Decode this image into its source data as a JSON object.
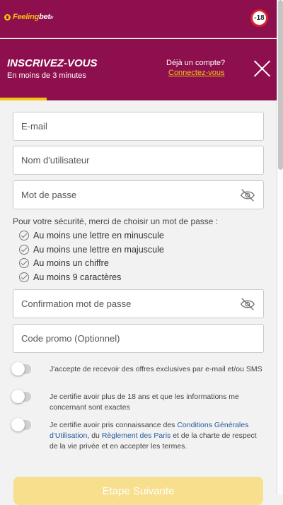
{
  "colors": {
    "brand": "#8e0f4d",
    "accent": "#f4c312",
    "link": "#235b9c",
    "button": "#f7df8e"
  },
  "header": {
    "logo": {
      "main": "Feeling",
      "strong": "bet",
      "suffix": "fr"
    },
    "age_badge": "-18"
  },
  "hero": {
    "title": "INSCRIVEZ-VOUS",
    "subtitle": "En moins de 3 minutes",
    "already": "Déjà un compte?",
    "login": "Connectez-vous",
    "progress": 0.17
  },
  "form": {
    "email_placeholder": "E-mail",
    "username_placeholder": "Nom d'utilisateur",
    "password_placeholder": "Mot de passe",
    "password_rules_title": "Pour votre sécurité, merci de choisir un mot de passe :",
    "rules": [
      "Au moins une lettre en minuscule",
      "Au moins une lettre en majuscule",
      "Au moins un chiffre",
      "Au moins 9 caractères"
    ],
    "confirm_placeholder": "Confirmation mot de passe",
    "promo_placeholder": "Code promo (Optionnel)",
    "offer_text": "J'accepte de recevoir des offres exclusives par e-mail et/ou SMS",
    "age_text": "Je certifie avoir plus de 18 ans et que les informations me concernant sont exactes",
    "terms_prefix": "Je certifie avoir pris connaissance des",
    "terms_link": "Conditions Générales d'Utilisation",
    "terms_middle": ", du",
    "rules_link": "Règlement des Paris",
    "terms_suffix": "et de la charte de respect de la vie privée et en accepter les termes.",
    "submit": "Etape Suivante"
  }
}
